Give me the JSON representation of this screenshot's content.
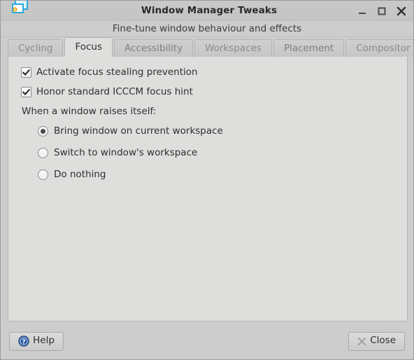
{
  "window": {
    "title": "Window Manager Tweaks",
    "subtitle": "Fine-tune window behaviour and effects",
    "icon": "window-settings-icon",
    "controls": [
      {
        "name": "minimize",
        "glyph": "minimize-icon"
      },
      {
        "name": "maximize",
        "glyph": "maximize-icon"
      },
      {
        "name": "close",
        "glyph": "close-icon"
      }
    ]
  },
  "tabs": [
    {
      "label": "Cycling",
      "active": false
    },
    {
      "label": "Focus",
      "active": true
    },
    {
      "label": "Accessibility",
      "active": false
    },
    {
      "label": "Workspaces",
      "active": false
    },
    {
      "label": "Placement",
      "active": false
    },
    {
      "label": "Compositor",
      "active": false
    }
  ],
  "focus_panel": {
    "checkboxes": [
      {
        "label": "Activate focus stealing prevention",
        "checked": true
      },
      {
        "label": "Honor standard ICCCM focus hint",
        "checked": true
      }
    ],
    "raise_section_label": "When a window raises itself:",
    "raise_options": [
      {
        "label": "Bring window on current workspace",
        "selected": true
      },
      {
        "label": "Switch to window's workspace",
        "selected": false
      },
      {
        "label": "Do nothing",
        "selected": false
      }
    ]
  },
  "actions": {
    "help_label": "Help",
    "help_icon": "help-circle-icon",
    "close_label": "Close",
    "close_icon": "close-x-icon"
  },
  "colors": {
    "window_bg": "#cdcdcd",
    "panel_bg": "#dededc",
    "accent_icon_blue": "#2f5fa8",
    "text": "#2f2f2f",
    "inactive_tab_text": "#8b8b8b"
  }
}
